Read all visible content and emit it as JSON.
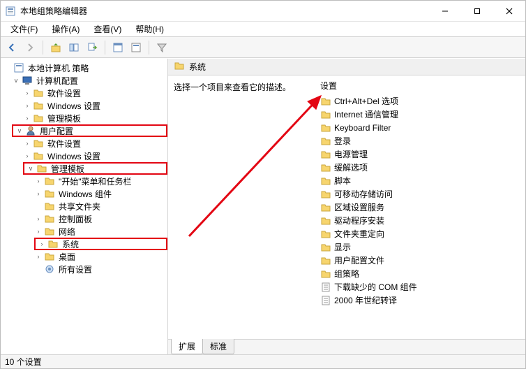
{
  "window": {
    "title": "本地组策略编辑器"
  },
  "menu": {
    "file": "文件(F)",
    "action": "操作(A)",
    "view": "查看(V)",
    "help": "帮助(H)"
  },
  "tree": {
    "root": "本地计算机 策略",
    "computer": "计算机配置",
    "comp_sw": "软件设置",
    "comp_win": "Windows 设置",
    "comp_admin": "管理模板",
    "user": "用户配置",
    "user_sw": "软件设置",
    "user_win": "Windows 设置",
    "user_admin": "管理模板",
    "start_task": "\"开始\"菜单和任务栏",
    "win_comp": "Windows 组件",
    "shared": "共享文件夹",
    "ctrl_panel": "控制面板",
    "network": "网络",
    "system": "系统",
    "desktop": "桌面",
    "all": "所有设置"
  },
  "path": {
    "label": "系统"
  },
  "desc": {
    "text": "选择一个项目来查看它的描述。"
  },
  "list": {
    "header": "设置",
    "items": [
      "Ctrl+Alt+Del 选项",
      "Internet 通信管理",
      "Keyboard Filter",
      "登录",
      "电源管理",
      "缓解选项",
      "脚本",
      "可移动存储访问",
      "区域设置服务",
      "驱动程序安装",
      "文件夹重定向",
      "显示",
      "用户配置文件",
      "组策略",
      "下载缺少的 COM 组件",
      "2000 年世纪转译"
    ]
  },
  "tabs": {
    "ext": "扩展",
    "std": "标准"
  },
  "status": {
    "text": "10 个设置"
  }
}
